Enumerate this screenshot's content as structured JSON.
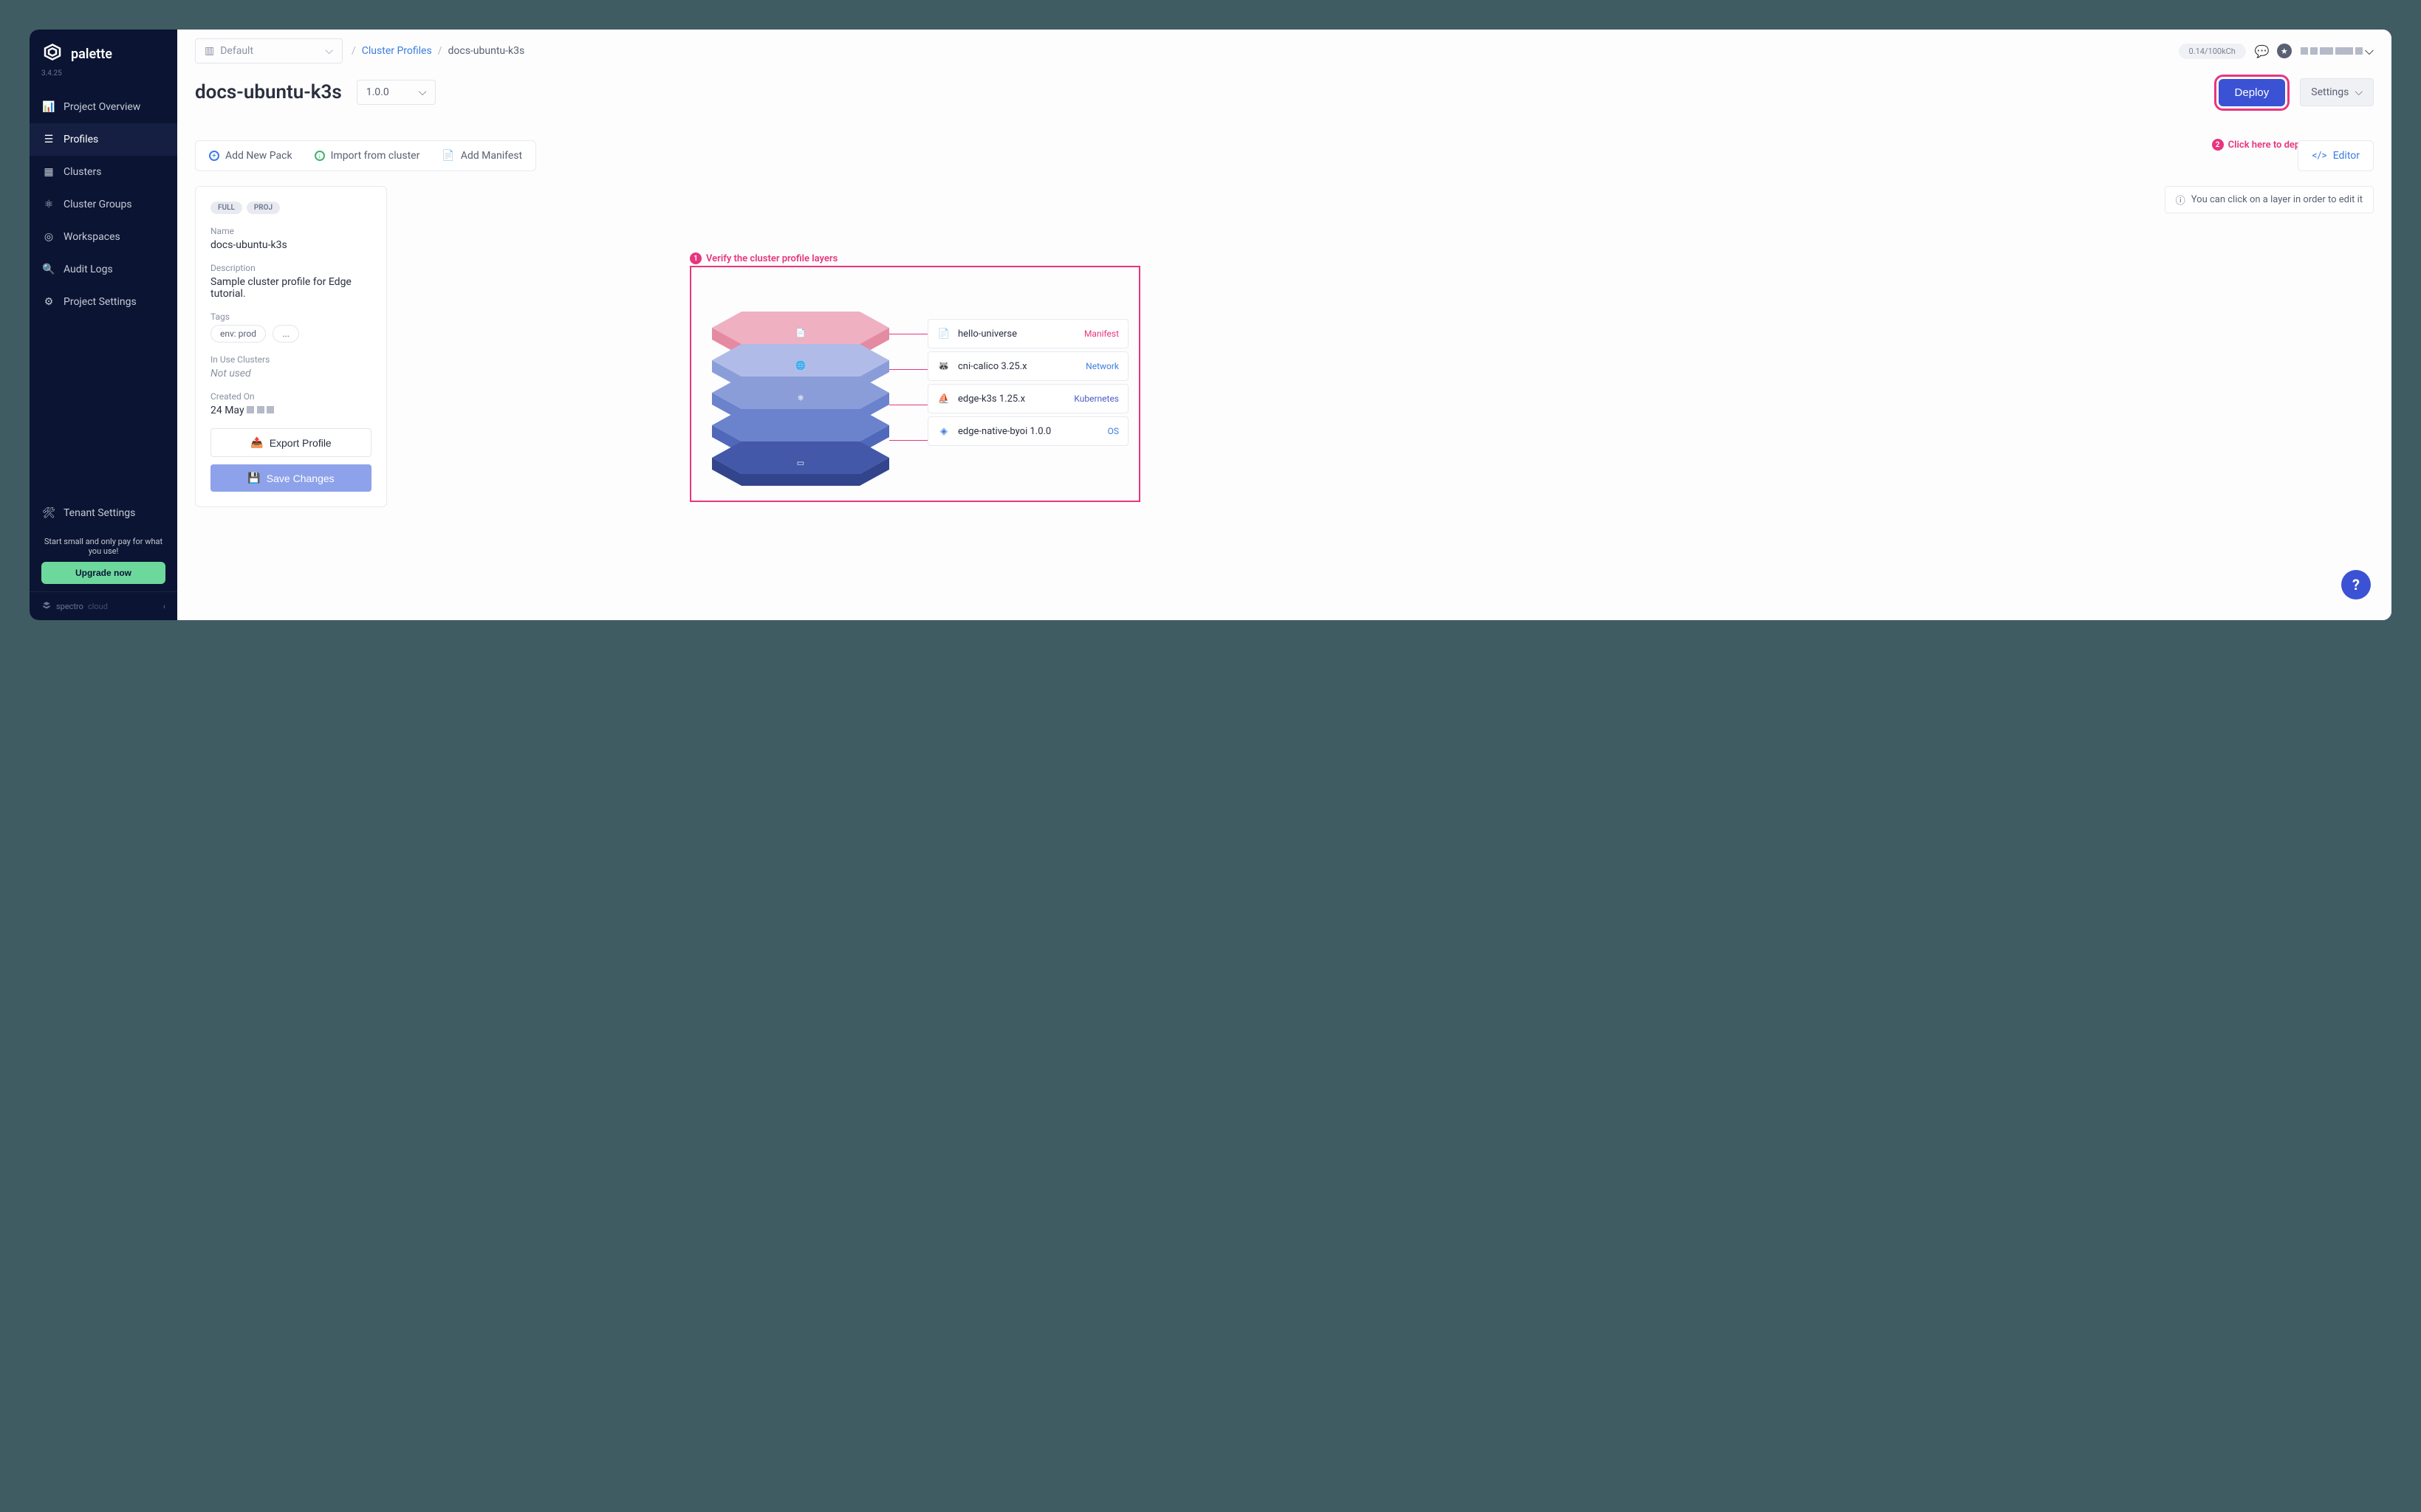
{
  "brand": {
    "name": "palette",
    "version": "3.4.25"
  },
  "sidebar": {
    "items": [
      {
        "label": "Project Overview"
      },
      {
        "label": "Profiles"
      },
      {
        "label": "Clusters"
      },
      {
        "label": "Cluster Groups"
      },
      {
        "label": "Workspaces"
      },
      {
        "label": "Audit Logs"
      },
      {
        "label": "Project Settings"
      },
      {
        "label": "Tenant Settings"
      }
    ],
    "promo_text": "Start small and only pay for what you use!",
    "upgrade_label": "Upgrade now",
    "footer_brand": "spectro",
    "footer_sub": "cloud"
  },
  "topbar": {
    "project_dd": "Default",
    "breadcrumb_link": "Cluster Profiles",
    "breadcrumb_current": "docs-ubuntu-k3s",
    "usage": "0.14/100kCh"
  },
  "header": {
    "title": "docs-ubuntu-k3s",
    "version": "1.0.0",
    "deploy_label": "Deploy",
    "settings_label": "Settings"
  },
  "callouts": {
    "c1": "Verify the cluster profile layers",
    "c2": "Click here to deploy a new cluster"
  },
  "actions": {
    "add_pack": "Add New Pack",
    "import": "Import from cluster",
    "add_manifest": "Add Manifest",
    "editor": "Editor"
  },
  "details": {
    "badge1": "FULL",
    "badge2": "PROJ",
    "name_label": "Name",
    "name_value": "docs-ubuntu-k3s",
    "desc_label": "Description",
    "desc_value": "Sample cluster profile for Edge tutorial.",
    "tags_label": "Tags",
    "tag1": "env: prod",
    "tag_more": "...",
    "inuse_label": "In Use Clusters",
    "inuse_value": "Not used",
    "created_label": "Created On",
    "created_value": "24 May",
    "export_label": "Export Profile",
    "save_label": "Save Changes"
  },
  "info_hint": "You can click on a layer in order to edit it",
  "layers": [
    {
      "name": "hello-universe",
      "type": "Manifest",
      "type_class": "lt-manifest",
      "icon": "📄"
    },
    {
      "name": "cni-calico 3.25.x",
      "type": "Network",
      "type_class": "lt-network",
      "icon": "🦝"
    },
    {
      "name": "edge-k3s 1.25.x",
      "type": "Kubernetes",
      "type_class": "lt-k8s",
      "icon": "⛵"
    },
    {
      "name": "edge-native-byoi 1.0.0",
      "type": "OS",
      "type_class": "lt-os",
      "icon": "◈"
    }
  ],
  "hex_colors": {
    "top_light": "#efb0c1",
    "top_dark": "#e58aa3",
    "mid1_light": "#b0bce7",
    "mid1_dark": "#8a9dd9",
    "mid2_light": "#8a9dd9",
    "mid2_dark": "#6b82cd",
    "mid3_light": "#6b82cd",
    "mid3_dark": "#5068b9",
    "bot_light": "#4358a8",
    "bot_dark": "#32458c"
  }
}
